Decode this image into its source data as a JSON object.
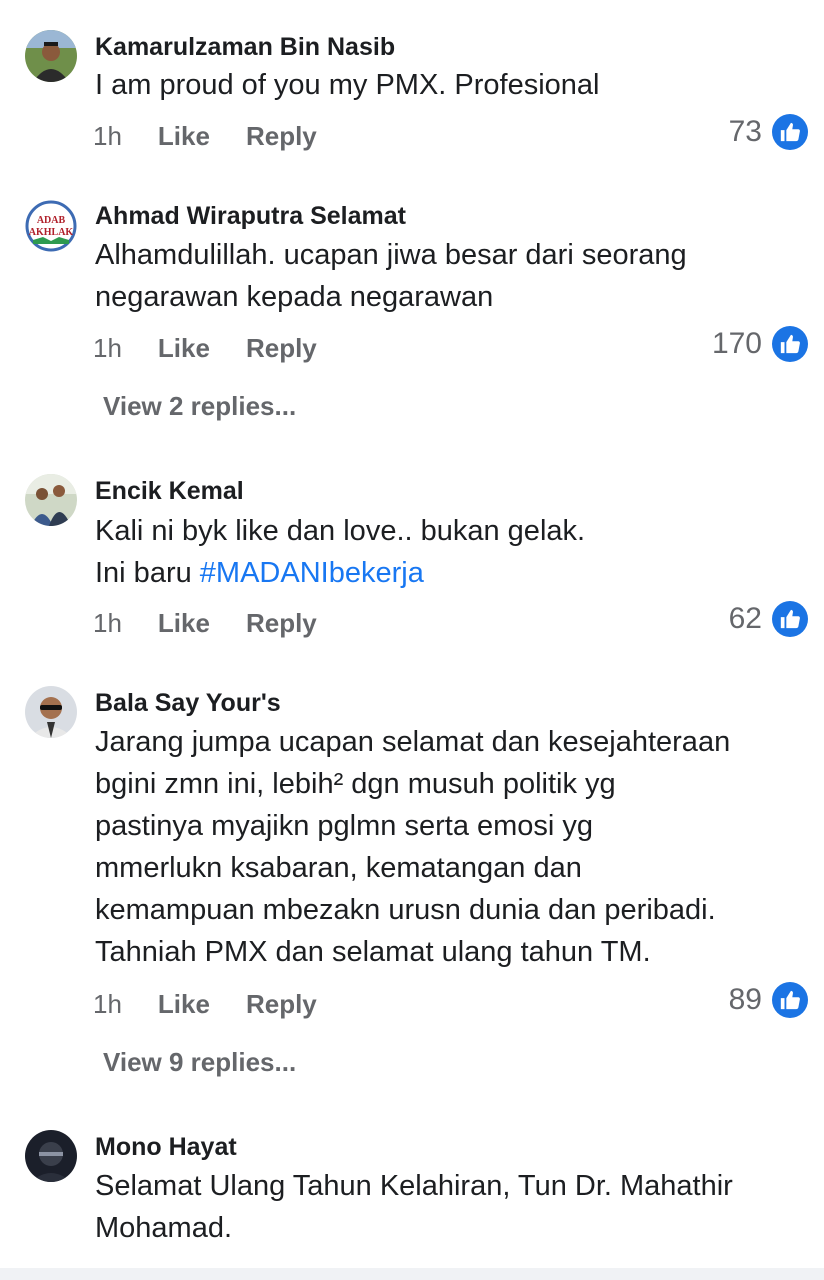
{
  "colors": {
    "author_text": "#1c1e21",
    "meta_text": "#65676b",
    "link_blue": "#1877f2",
    "like_badge": "#1b74e4"
  },
  "comments": [
    {
      "author": "Kamarulzaman Bin Nasib",
      "lines": [
        "I am proud of you my PMX. Profesional"
      ],
      "time": "1h",
      "like_label": "Like",
      "reply_label": "Reply",
      "reactions": "73"
    },
    {
      "author": "Ahmad Wiraputra Selamat",
      "avatar_text": [
        "ADAB",
        "AKHLAK"
      ],
      "lines": [
        "Alhamdulillah. ucapan jiwa besar dari seorang",
        "negarawan kepada negarawan"
      ],
      "time": "1h",
      "like_label": "Like",
      "reply_label": "Reply",
      "reactions": "170",
      "view_replies": "View 2 replies..."
    },
    {
      "author": "Encik Kemal",
      "lines": [
        "Kali ni byk like dan love.. bukan gelak."
      ],
      "line2_prefix": "Ini baru ",
      "hashtag": "#MADANIbekerja",
      "time": "1h",
      "like_label": "Like",
      "reply_label": "Reply",
      "reactions": "62"
    },
    {
      "author": "Bala Say Your's",
      "lines": [
        "Jarang jumpa ucapan selamat dan kesejahteraan",
        "bgini zmn ini, lebih² dgn musuh politik yg",
        "pastinya myajikn pglmn serta emosi yg",
        "mmerlukn ksabaran, kematangan dan",
        "kemampuan mbezakn urusn dunia dan peribadi.",
        "Tahniah PMX dan selamat ulang tahun TM."
      ],
      "time": "1h",
      "like_label": "Like",
      "reply_label": "Reply",
      "reactions": "89",
      "view_replies": "View 9 replies..."
    },
    {
      "author": "Mono Hayat",
      "lines": [
        "Selamat Ulang Tahun Kelahiran, Tun Dr. Mahathir",
        "Mohamad."
      ]
    }
  ]
}
